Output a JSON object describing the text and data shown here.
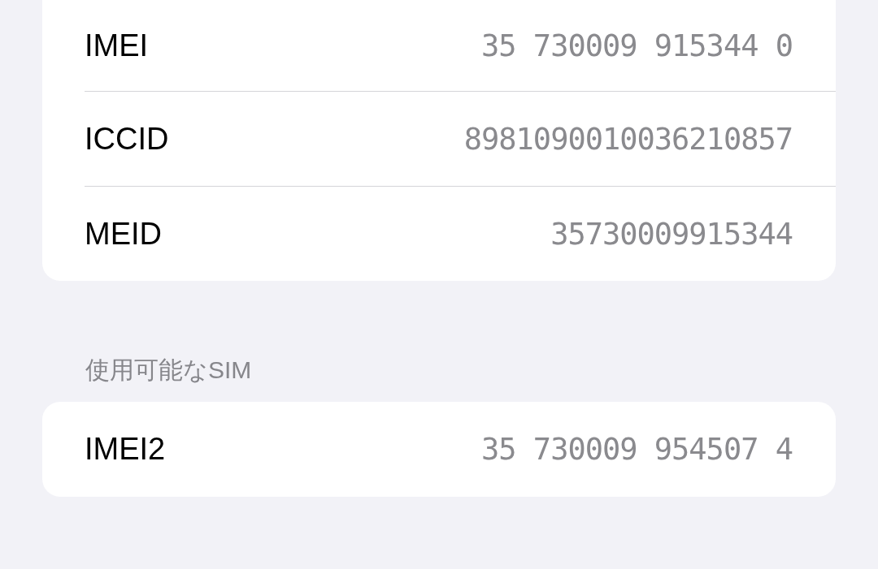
{
  "device_info": [
    {
      "label": "IMEI",
      "value": "35 730009 915344 0"
    },
    {
      "label": "ICCID",
      "value": "8981090010036210857"
    },
    {
      "label": "MEID",
      "value": "35730009915344"
    }
  ],
  "available_sim": {
    "header": "使用可能なSIM",
    "rows": [
      {
        "label": "IMEI2",
        "value": "35 730009 954507 4"
      }
    ]
  }
}
